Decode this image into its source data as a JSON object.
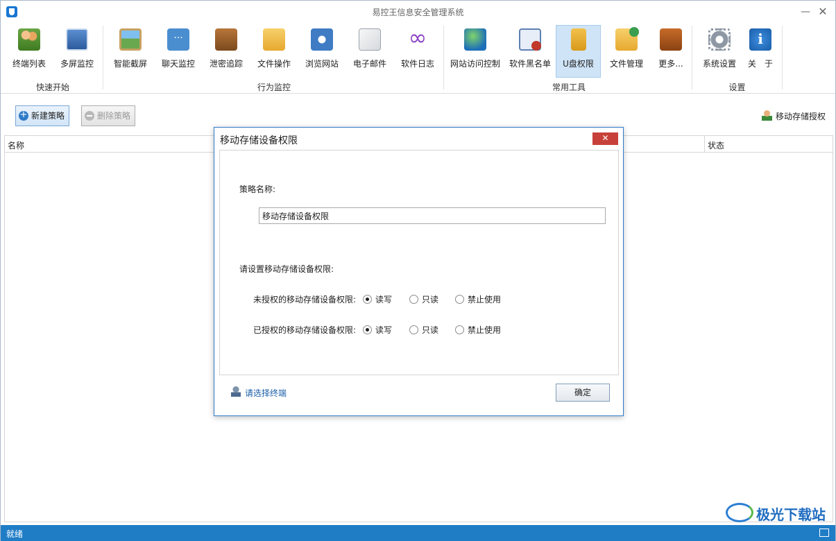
{
  "window": {
    "title": "易控王信息安全管理系统",
    "minimize": "—",
    "close": "✕"
  },
  "ribbon": {
    "groups": [
      {
        "label": "快速开始",
        "tools": [
          "终端列表",
          "多屏监控"
        ]
      },
      {
        "label": "行为监控",
        "tools": [
          "智能截屏",
          "聊天监控",
          "泄密追踪",
          "文件操作",
          "浏览网站",
          "电子邮件",
          "软件日志"
        ]
      },
      {
        "label": "常用工具",
        "tools": [
          "网站访问控制",
          "软件黑名单",
          "U盘权限",
          "文件管理",
          "更多..."
        ]
      },
      {
        "label": "设置",
        "tools": [
          "系统设置",
          "关　于"
        ]
      }
    ],
    "active_tool": "U盘权限"
  },
  "actions": {
    "new_policy": "新建策略",
    "delete_policy": "删除策略",
    "storage_auth": "移动存储授权"
  },
  "table": {
    "columns": [
      "名称",
      "状态"
    ]
  },
  "dialog": {
    "title": "移动存储设备权限",
    "close": "✕",
    "name_label": "策略名称:",
    "name_value": "移动存储设备权限",
    "section_label": "请设置移动存储设备权限:",
    "rows": [
      {
        "label": "未授权的移动存储设备权限:",
        "options": [
          "读写",
          "只读",
          "禁止使用"
        ],
        "selected": "读写"
      },
      {
        "label": "已授权的移动存储设备权限:",
        "options": [
          "读写",
          "只读",
          "禁止使用"
        ],
        "selected": "读写"
      }
    ],
    "select_terminal": "请选择终端",
    "ok": "确定"
  },
  "status": {
    "text": "就绪"
  },
  "watermark": {
    "text": "极光下载站"
  }
}
